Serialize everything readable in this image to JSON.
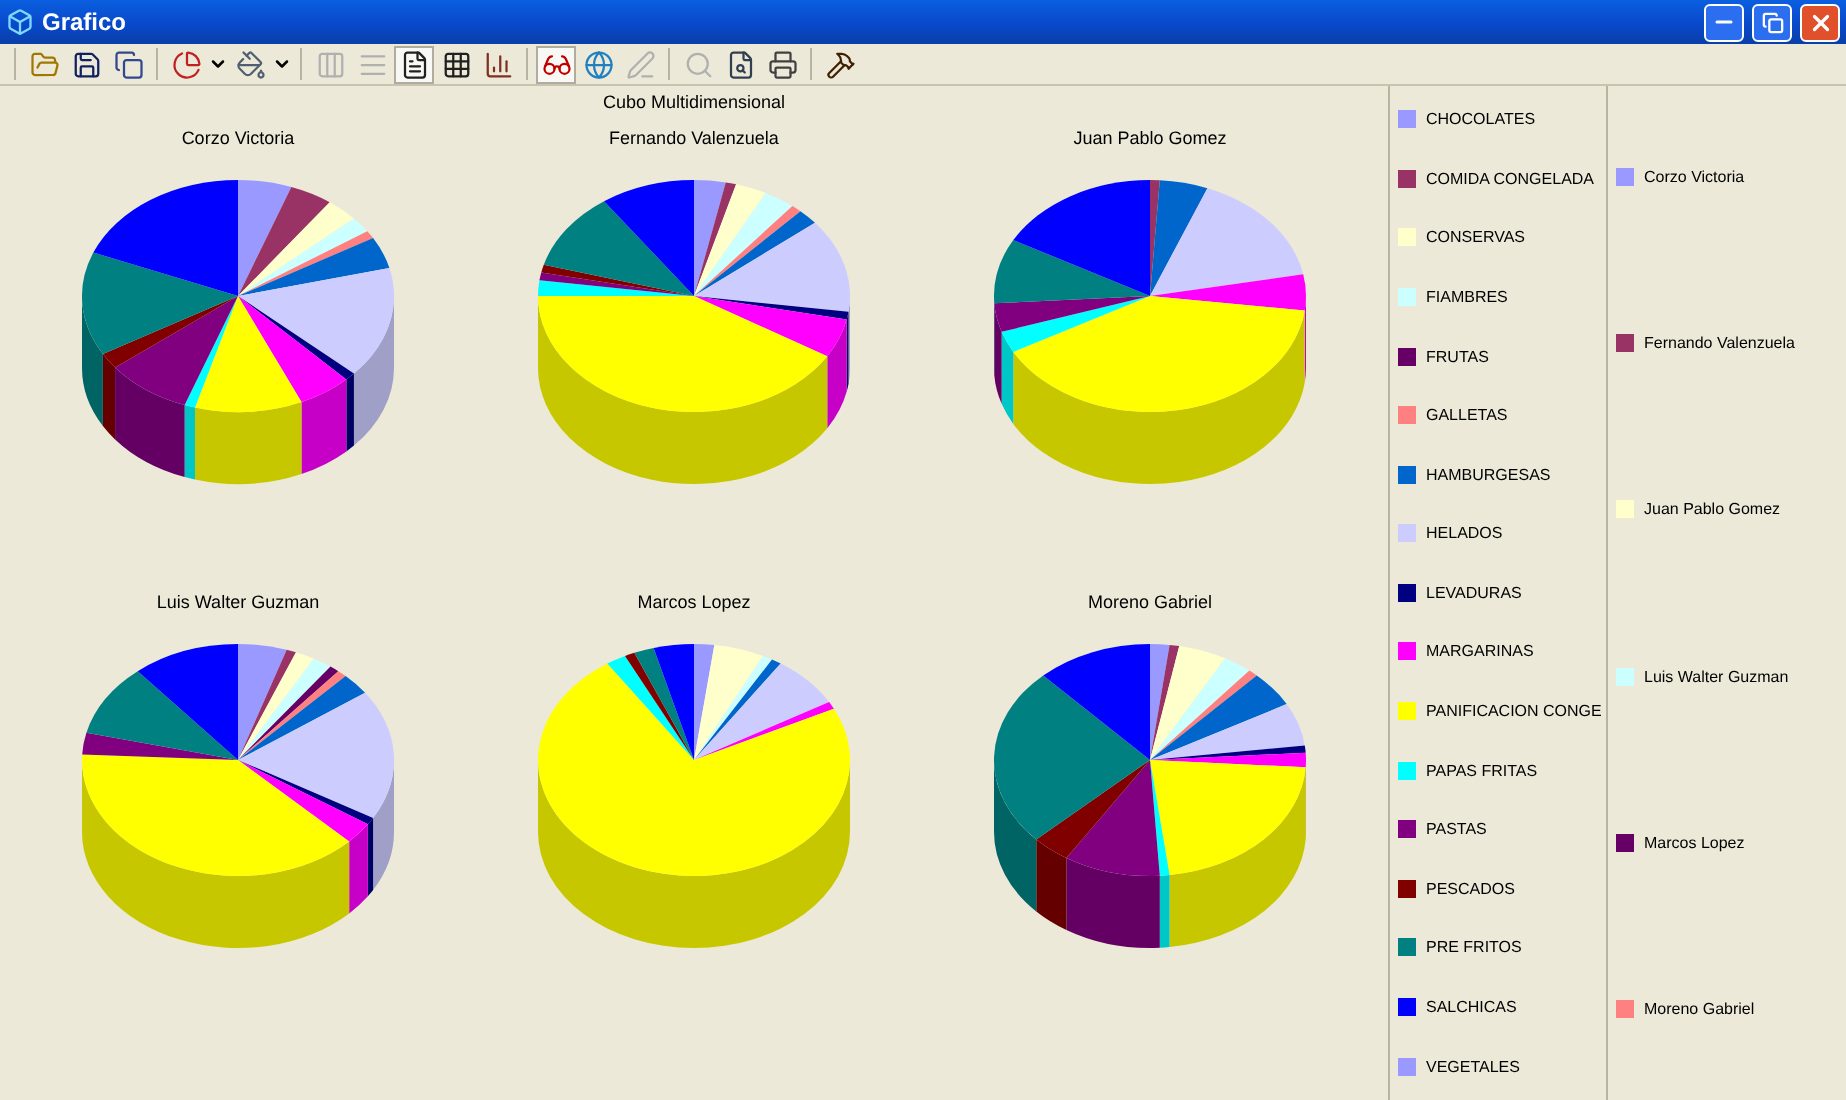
{
  "window": {
    "title": "Grafico"
  },
  "chart": {
    "title": "Cubo Multidimensional",
    "pies": [
      {
        "title": "Corzo Victoria"
      },
      {
        "title": "Fernando Valenzuela"
      },
      {
        "title": "Juan Pablo Gomez"
      },
      {
        "title": "Luis Walter Guzman"
      },
      {
        "title": "Marcos Lopez"
      },
      {
        "title": "Moreno Gabriel"
      }
    ]
  },
  "legend_categories": [
    {
      "label": "CHOCOLATES",
      "color": "#9999ff"
    },
    {
      "label": "COMIDA CONGELADA",
      "color": "#993366"
    },
    {
      "label": "CONSERVAS",
      "color": "#ffffcc"
    },
    {
      "label": "FIAMBRES",
      "color": "#ccffff"
    },
    {
      "label": "FRUTAS",
      "color": "#660066"
    },
    {
      "label": "GALLETAS",
      "color": "#ff8080"
    },
    {
      "label": "HAMBURGESAS",
      "color": "#0066cc"
    },
    {
      "label": "HELADOS",
      "color": "#ccccff"
    },
    {
      "label": "LEVADURAS",
      "color": "#000080"
    },
    {
      "label": "MARGARINAS",
      "color": "#ff00ff"
    },
    {
      "label": "PANIFICACION CONGE",
      "color": "#ffff00"
    },
    {
      "label": "PAPAS FRITAS",
      "color": "#00ffff"
    },
    {
      "label": "PASTAS",
      "color": "#800080"
    },
    {
      "label": "PESCADOS",
      "color": "#800000"
    },
    {
      "label": "PRE FRITOS",
      "color": "#008080"
    },
    {
      "label": "SALCHICAS",
      "color": "#0000ff"
    },
    {
      "label": "VEGETALES",
      "color": "#9999ff"
    }
  ],
  "legend_series": [
    {
      "label": "Corzo Victoria",
      "color": "#9999ff"
    },
    {
      "label": "Fernando Valenzuela",
      "color": "#993366"
    },
    {
      "label": "Juan Pablo Gomez",
      "color": "#ffffcc"
    },
    {
      "label": "Luis Walter Guzman",
      "color": "#ccffff"
    },
    {
      "label": "Marcos Lopez",
      "color": "#660066"
    },
    {
      "label": "Moreno Gabriel",
      "color": "#ff8080"
    }
  ]
}
